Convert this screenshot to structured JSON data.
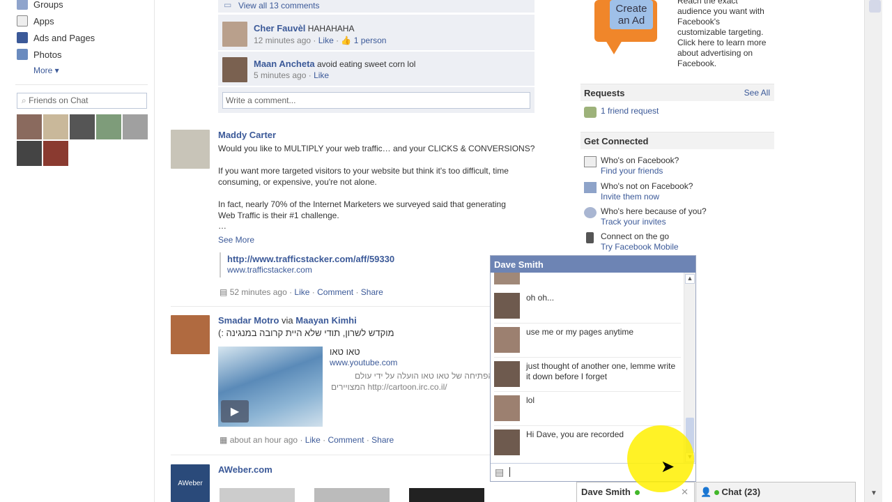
{
  "colors": {
    "link": "#3b5998",
    "chat_header": "#6d84b4",
    "comment_bg": "#edeff4",
    "online": "#42b72a",
    "cursor_highlight": "#fff000"
  },
  "left": {
    "nav": [
      {
        "label": "Groups",
        "icon": "groups-icon"
      },
      {
        "label": "Apps",
        "icon": "apps-icon"
      },
      {
        "label": "Ads and Pages",
        "icon": "ads-pages-icon"
      },
      {
        "label": "Photos",
        "icon": "photos-icon"
      }
    ],
    "more": "More ▾",
    "chat_search_placeholder": "Friends on Chat"
  },
  "feed": {
    "view_all_comments": "View all 13 comments",
    "comments": [
      {
        "author": "Cher Fauvèl",
        "text": "HAHAHAHA",
        "time": "12 minutes ago",
        "like": "Like",
        "likes": "1 person"
      },
      {
        "author": "Maan Ancheta",
        "text": "avoid eating sweet corn lol",
        "time": "5 minutes ago",
        "like": "Like"
      }
    ],
    "write_comment": "Write a comment...",
    "post1": {
      "author": "Maddy Carter",
      "line1": "Would you like to MULTIPLY your web traffic… and your CLICKS & CONVERSIONS?",
      "para2a": "If you want more targeted visitors to your website but think it's too difficult, time",
      "para2b": "consuming, or expensive, you're not alone.",
      "para3a": "In fact, nearly 70% of the Internet Marketers we surveyed said that generating",
      "para3b": "Web Traffic is their #1 challenge.",
      "ellipsis": "…",
      "see_more": "See More",
      "link_title": "http://www.trafficstacker.com/aff/59330",
      "link_domain": "www.trafficstacker.com",
      "time": "52 minutes ago",
      "like": "Like",
      "comment": "Comment",
      "share": "Share"
    },
    "post2": {
      "author": "Smadar Motro",
      "via": "via",
      "via_author": "Maayan Kimhi",
      "text": "מוקדש לשרון, תודי שלא היית קרובה במנגינה :)",
      "video_title": "טאו טאו",
      "video_domain": "www.youtube.com",
      "video_desc_a": "הפתיחה של טאו טאו הועלה על ידי עולם",
      "video_desc_b": "המצויירים",
      "video_desc_link": "http://cartoon.irc.co.il/",
      "time": "about an hour ago",
      "like": "Like",
      "comment": "Comment",
      "share": "Share"
    },
    "post3": {
      "author": "AWeber.com",
      "logo_text": "AWeber"
    }
  },
  "right": {
    "ad_badge": "Create an Ad",
    "ad_text": [
      "Reach the exact",
      "audience you want with",
      "Facebook's",
      "customizable targeting.",
      "Click here to learn more",
      "about advertising on",
      "Facebook."
    ],
    "requests_title": "Requests",
    "see_all": "See All",
    "friend_request": "1 friend request",
    "get_connected": "Get Connected",
    "connect_items": [
      {
        "t1": "Who's on Facebook?",
        "t2": "Find your friends"
      },
      {
        "t1": "Who's not on Facebook?",
        "t2": "Invite them now"
      },
      {
        "t1": "Who's here because of you?",
        "t2": "Track your invites"
      },
      {
        "t1": "Connect on the go",
        "t2": "Try Facebook Mobile"
      }
    ]
  },
  "chat": {
    "title": "Dave Smith",
    "messages": [
      {
        "text": "oh oh..."
      },
      {
        "text": "use me or my pages anytime"
      },
      {
        "text": "just thought of another one, lemme write it down before I forget"
      },
      {
        "text": "lol"
      },
      {
        "text": "Hi Dave, you are recorded"
      }
    ],
    "tab_name": "Dave Smith",
    "close": "✕",
    "chat_count": "Chat (23)"
  }
}
